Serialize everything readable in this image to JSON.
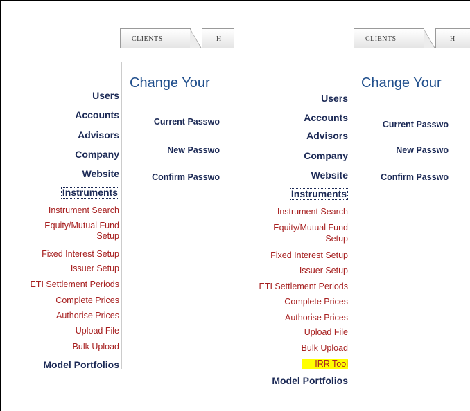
{
  "tabs": {
    "clients": "CLIENTS",
    "next": "H"
  },
  "content": {
    "title": "Change Your",
    "fields": [
      "Current Passwo",
      "New Passwo",
      "Confirm Passwo"
    ]
  },
  "nav": {
    "users": "Users",
    "accounts": "Accounts",
    "advisors": "Advisors",
    "company": "Company",
    "website": "Website",
    "instruments": "Instruments",
    "instrument_search": "Instrument Search",
    "equity_line1": "Equity/Mutual Fund",
    "equity_line2": "Setup",
    "fixed_interest": "Fixed Interest Setup",
    "issuer_setup": "Issuer Setup",
    "eti_settlement": "ETI Settlement Periods",
    "complete_prices": "Complete Prices",
    "authorise_prices": "Authorise Prices",
    "upload_file": "Upload File",
    "bulk_upload": "Bulk Upload",
    "irr_tool": "IRR Tool",
    "model_portfolios": "Model Portfolios"
  },
  "colors": {
    "nav_bold": "#1c2a56",
    "nav_sub": "#a72020",
    "title": "#1f4e8c",
    "highlight": "#ffff00"
  }
}
